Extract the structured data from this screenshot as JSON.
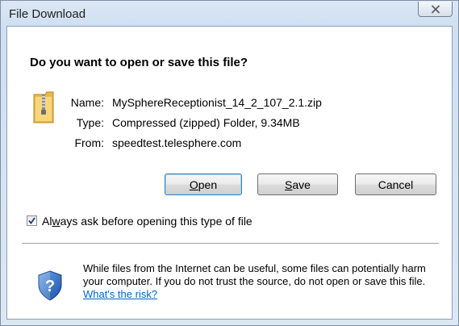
{
  "window": {
    "title": "File Download",
    "close_glyph": "✕"
  },
  "dialog": {
    "question": "Do you want to open or save this file?",
    "file": {
      "name_label": "Name:",
      "name_value": "MySphereReceptionist_14_2_107_2.1.zip",
      "type_label": "Type:",
      "type_value": "Compressed (zipped) Folder, 9.34MB",
      "from_label": "From:",
      "from_value": "speedtest.telesphere.com",
      "icon": "zip-folder-icon"
    },
    "buttons": {
      "open_accel": "O",
      "open_rest": "pen",
      "save_accel": "S",
      "save_rest": "ave",
      "cancel": "Cancel"
    },
    "checkbox": {
      "label_pre": "Al",
      "label_accel": "w",
      "label_post": "ays ask before opening this type of file",
      "checked": true
    },
    "warning": {
      "icon": "shield-question-icon",
      "text": "While files from the Internet can be useful, some files can potentially harm your computer. If you do not trust the source, do not open or save this file.",
      "link": "What's the risk?"
    }
  },
  "colors": {
    "link": "#0066cc",
    "frame_border": "#7d8fa6",
    "default_button_border": "#3c7fb1"
  }
}
